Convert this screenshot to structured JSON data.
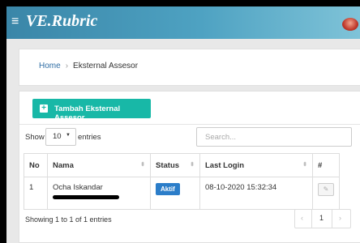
{
  "app": {
    "menu_icon": "≡",
    "title": "VE.Rubric",
    "avatar_icon": "user-avatar"
  },
  "breadcrumb": {
    "home": "Home",
    "separator": "›",
    "current": "Eksternal Assesor"
  },
  "toolbar": {
    "add_label": "Tambah Eksternal Assesor",
    "add_icon": "plus"
  },
  "table_controls": {
    "show_label": "Show",
    "entries_value": "10",
    "entries_label": "entries",
    "search_placeholder": "Search..."
  },
  "table": {
    "headers": [
      "No",
      "Nama",
      "Status",
      "Last Login",
      "#"
    ],
    "rows": [
      {
        "no": "1",
        "nama": "Ocha Iskandar",
        "status": "Aktif",
        "last_login": "08-10-2020 15:32:34"
      }
    ]
  },
  "footer": {
    "info": "Showing 1 to 1 of 1 entries",
    "prev": "‹",
    "page": "1",
    "next": "›"
  },
  "colors": {
    "topbar": "#3a86a8",
    "add_button": "#18b8a7",
    "badge": "#2b7dc9"
  }
}
